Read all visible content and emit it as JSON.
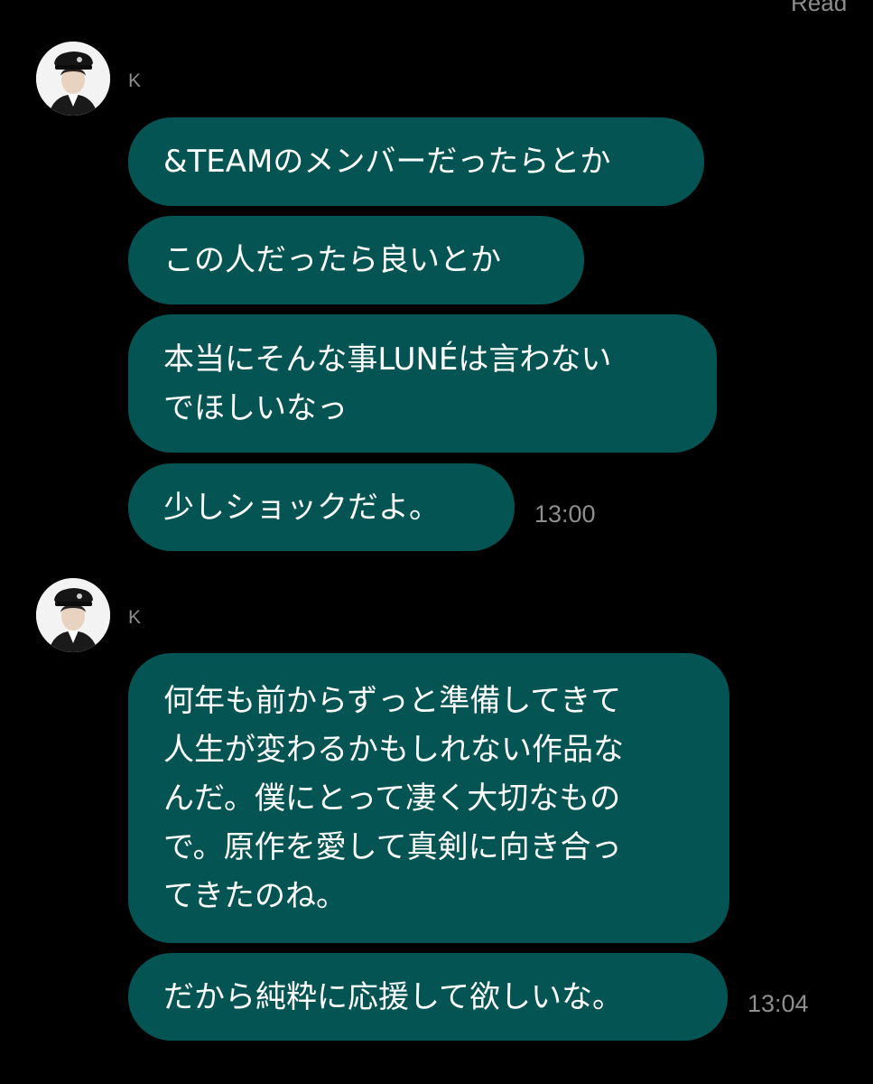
{
  "status": {
    "read_label": "Read"
  },
  "groups": [
    {
      "sender": "K",
      "messages": [
        "&TEAMのメンバーだったらとか",
        "この人だったら良いとか",
        "本当にそんな事LUNÉは言わない\nでほしいなっ",
        "少しショックだよ。"
      ],
      "time": "13:00"
    },
    {
      "sender": "K",
      "messages": [
        "何年も前からずっと準備してきて\n人生が変わるかもしれない作品な\nんだ。僕にとって凄く大切なもの\nで。原作を愛して真剣に向き合っ\nてきたのね。",
        "だから純粋に応援して欲しいな。"
      ],
      "time": "13:04"
    }
  ],
  "colors": {
    "background": "#000000",
    "bubble": "#045454",
    "meta_text": "#8e8e8e"
  },
  "icons": {
    "avatar": "profile-photo"
  }
}
